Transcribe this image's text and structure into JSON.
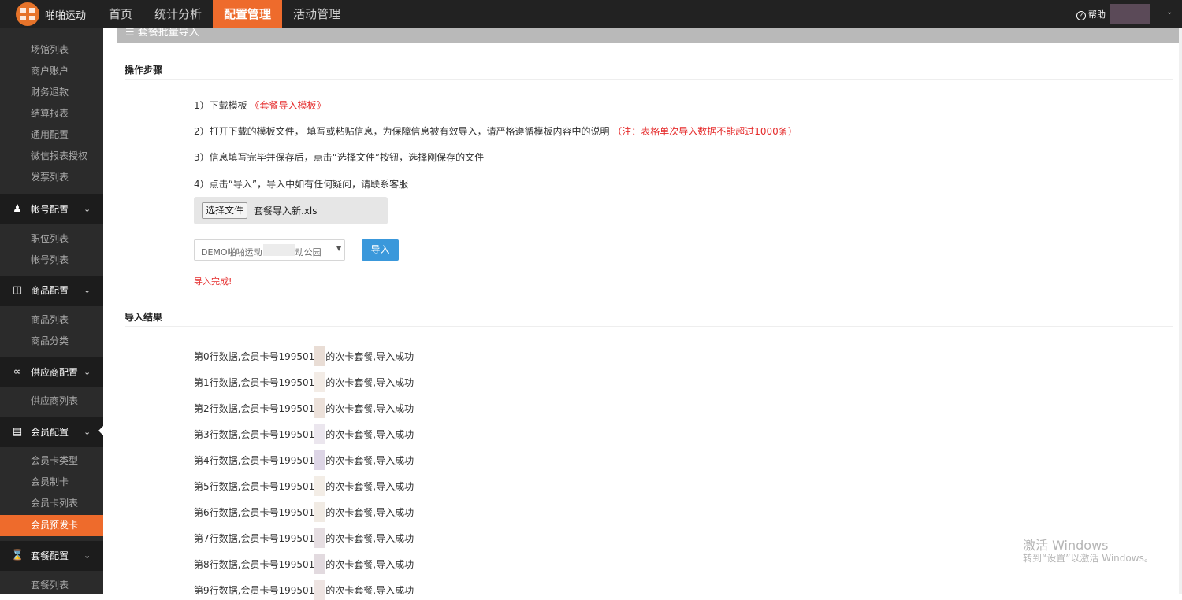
{
  "header": {
    "brand": "啪啪运动",
    "nav": [
      "首页",
      "统计分析",
      "配置管理",
      "活动管理"
    ],
    "active_nav": "配置管理",
    "help": "帮助",
    "accent_color": "#ee6b2c"
  },
  "sidebar": {
    "top_items": [
      "场馆列表",
      "商户账户",
      "财务退款",
      "结算报表",
      "通用配置",
      "微信报表授权",
      "发票列表"
    ],
    "groups": [
      {
        "label": "帐号配置",
        "icon": "user-icon",
        "items": [
          "职位列表",
          "帐号列表"
        ]
      },
      {
        "label": "商品配置",
        "icon": "gift-icon",
        "items": [
          "商品列表",
          "商品分类"
        ]
      },
      {
        "label": "供应商配置",
        "icon": "link-icon",
        "items": [
          "供应商列表"
        ]
      },
      {
        "label": "会员配置",
        "icon": "id-card-icon",
        "items": [
          "会员卡类型",
          "会员制卡",
          "会员卡列表",
          "会员预发卡"
        ]
      },
      {
        "label": "套餐配置",
        "icon": "hourglass-icon",
        "items": [
          "套餐列表"
        ]
      }
    ],
    "active_item": "会员预发卡"
  },
  "panel": {
    "title": "套餐批量导入",
    "steps_title": "操作步骤",
    "steps": [
      {
        "text": "1）下载模板 ",
        "link": "《套餐导入模板》"
      },
      {
        "text": "2）打开下载的模板文件， 填写或粘贴信息，为保障信息被有效导入，请严格遵循模板内容中的说明 ",
        "note": "（注：表格单次导入数据不能超过1000条）"
      },
      {
        "text": "3）信息填写完毕并保存后，点击“选择文件”按钮，选择刚保存的文件"
      },
      {
        "text": "4）点击“导入”，导入中如有任何疑问，请联系客服"
      }
    ],
    "file_button": "选择文件",
    "file_name": "套餐导入新.xls",
    "venue_select": {
      "prefix": "DEMO啪啪运动",
      "suffix": "动公园"
    },
    "import_button": "导入",
    "done_message": "导入完成!",
    "results_title": "导入结果",
    "results": [
      {
        "prefix": "第0行数据,会员卡号199501",
        "suffix": "的次卡套餐,导入成功",
        "mask": "#e9ddd5"
      },
      {
        "prefix": "第1行数据,会员卡号199501",
        "suffix": "的次卡套餐,导入成功",
        "mask": "#f3ece6"
      },
      {
        "prefix": "第2行数据,会员卡号199501",
        "suffix": "的次卡套餐,导入成功",
        "mask": "#ece1da"
      },
      {
        "prefix": "第3行数据,会员卡号199501",
        "suffix": "的次卡套餐,导入成功",
        "mask": "#ebe6ee"
      },
      {
        "prefix": "第4行数据,会员卡号199501",
        "suffix": "的次卡套餐,导入成功",
        "mask": "#ddd5e6"
      },
      {
        "prefix": "第5行数据,会员卡号199501",
        "suffix": "的次卡套餐,导入成功",
        "mask": "#f3ede6"
      },
      {
        "prefix": "第6行数据,会员卡号199501",
        "suffix": "的次卡套餐,导入成功",
        "mask": "#f1ebe4"
      },
      {
        "prefix": "第7行数据,会员卡号199501",
        "suffix": "的次卡套餐,导入成功",
        "mask": "#e6dee2"
      },
      {
        "prefix": "第8行数据,会员卡号199501",
        "suffix": "的次卡套餐,导入成功",
        "mask": "#e2dadf"
      },
      {
        "prefix": "第9行数据,会员卡号199501",
        "suffix": "的次卡套餐,导入成功",
        "mask": "#eee4e2"
      }
    ]
  },
  "watermark": {
    "line1": "激活 Windows",
    "line2": "转到“设置”以激活 Windows。"
  }
}
